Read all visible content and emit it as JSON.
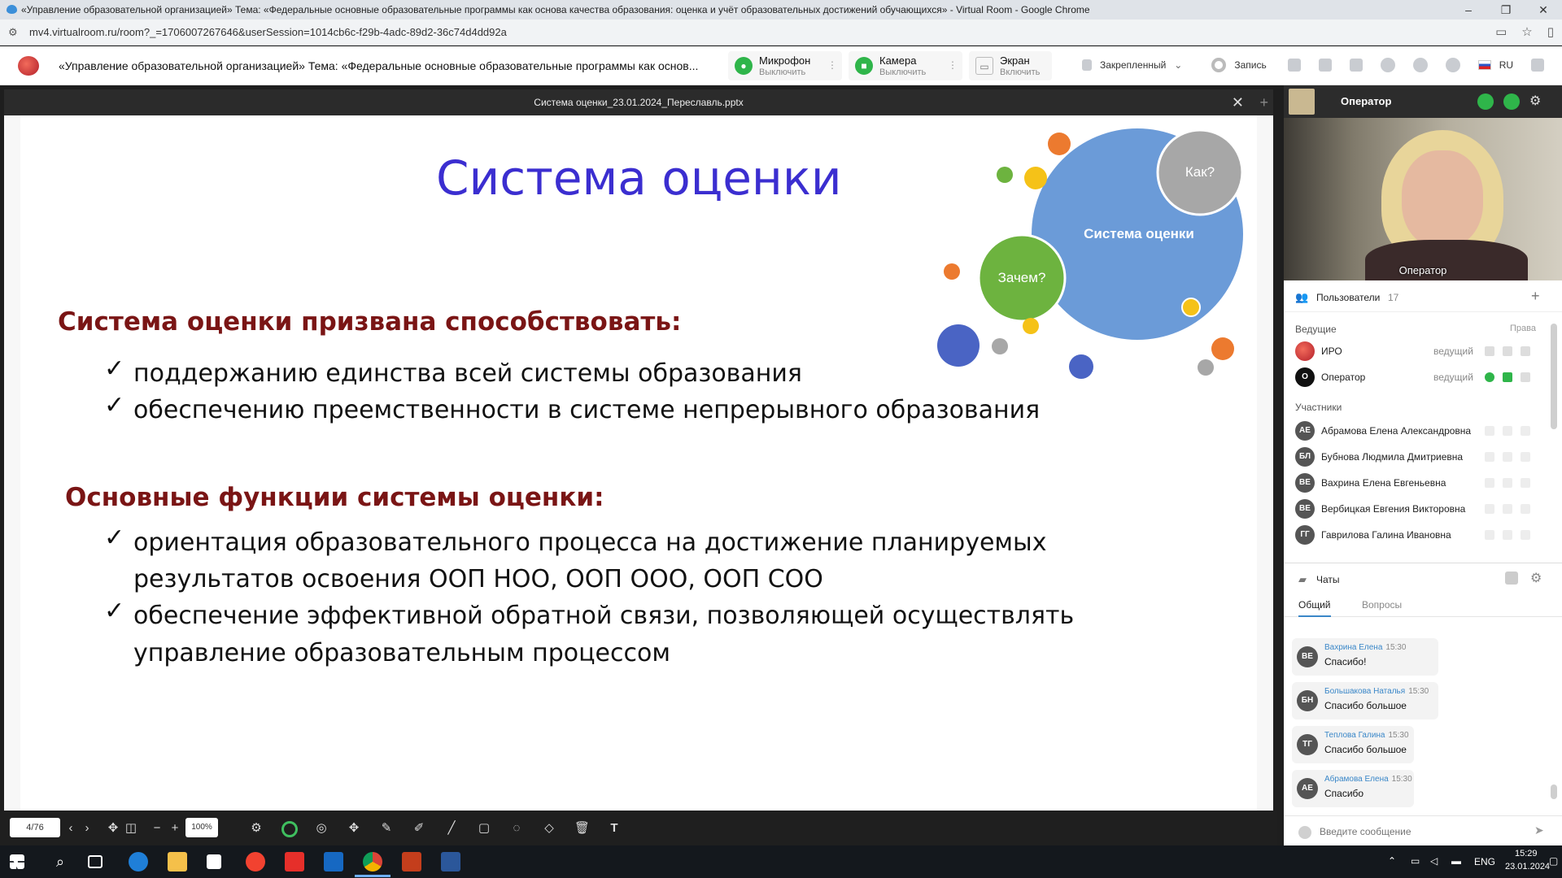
{
  "browser": {
    "window_title": "«Управление образовательной организацией» Тема: «Федеральные основные образовательные программы как основа качества образования: оценка и учёт образовательных достижений обучающихся» - Virtual Room - Google Chrome",
    "url": "mv4.virtualroom.ru/room?_=1706007267646&userSession=1014cb6c-f29b-4adc-89d2-36c74d4dd92a",
    "win_minimize": "–",
    "win_restore": "❐",
    "win_close": "✕"
  },
  "header": {
    "title": "«Управление образовательной организацией» Тема: «Федеральные основные образовательные программы как основ...",
    "mic": {
      "label": "Микрофон",
      "action": "Выключить"
    },
    "camera": {
      "label": "Камера",
      "action": "Выключить"
    },
    "screen": {
      "label": "Экран",
      "action": "Включить"
    },
    "pinned": "Закрепленный",
    "record": "Запись",
    "lang": "RU"
  },
  "presentation": {
    "file_name": "Система оценки_23.01.2024_Переславль.pptx",
    "slide": {
      "title": "Система оценки",
      "section1_heading": "Система оценки призвана способствовать:",
      "section1_items": [
        "поддержанию единства всей системы образования",
        "обеспечению преемственности в системе непрерывного образования"
      ],
      "section2_heading": "Основные функции системы оценки:",
      "section2_items": [
        {
          "line1": "ориентация образовательного процесса на достижение планируемых",
          "line2": "результатов освоения ООП НОО, ООП ООО, ООП СОО"
        },
        {
          "line1": "обеспечение эффективной обратной связи, позволяющей осуществлять",
          "line2": "управление образовательным процессом"
        }
      ],
      "bubble_main": "Система оценки",
      "bubble_how": "Как?",
      "bubble_why": "Зачем?",
      "check_glyph": "✓"
    },
    "toolbar": {
      "page": "4/76",
      "zoom": "100%"
    }
  },
  "operator": {
    "name": "Оператор",
    "video_label": "Оператор"
  },
  "users": {
    "title": "Пользователи",
    "count": "17",
    "hosts_label": "Ведущие",
    "rights_label": "Права",
    "hosts": [
      {
        "initials": "",
        "name": "ИРО",
        "role": "ведущий"
      },
      {
        "initials": "О",
        "name": "Оператор",
        "role": "ведущий"
      }
    ],
    "participants_label": "Участники",
    "participants": [
      {
        "initials": "АЕ",
        "name": "Абрамова Елена Александровна"
      },
      {
        "initials": "БЛ",
        "name": "Бубнова Людмила Дмитриевна"
      },
      {
        "initials": "ВЕ",
        "name": "Вахрина Елена Евгеньевна"
      },
      {
        "initials": "ВЕ",
        "name": "Вербицкая Евгения Викторовна"
      },
      {
        "initials": "ГГ",
        "name": "Гаврилова Галина Ивановна"
      }
    ]
  },
  "chat": {
    "title": "Чаты",
    "tabs": [
      "Общий",
      "Вопросы"
    ],
    "messages": [
      {
        "initials": "ВЕ",
        "author": "Вахрина Елена",
        "time": "15:30",
        "text": "Спасибо!"
      },
      {
        "initials": "БН",
        "author": "Большакова Наталья",
        "time": "15:30",
        "text": "Спасибо большое"
      },
      {
        "initials": "ТГ",
        "author": "Теплова Галина",
        "time": "15:30",
        "text": "Спасибо большое"
      },
      {
        "initials": "АЕ",
        "author": "Абрамова Елена",
        "time": "15:30",
        "text": "Спасибо"
      }
    ],
    "input_placeholder": "Введите сообщение"
  },
  "taskbar": {
    "lang": "ENG",
    "time": "15:29",
    "date": "23.01.2024"
  },
  "colors": {
    "accent_green": "#2fb54a",
    "title_purple": "#3b2ed0",
    "heading_maroon": "#7a1515",
    "bubble_blue": "#6b9bd8",
    "bubble_green": "#6db33f"
  }
}
